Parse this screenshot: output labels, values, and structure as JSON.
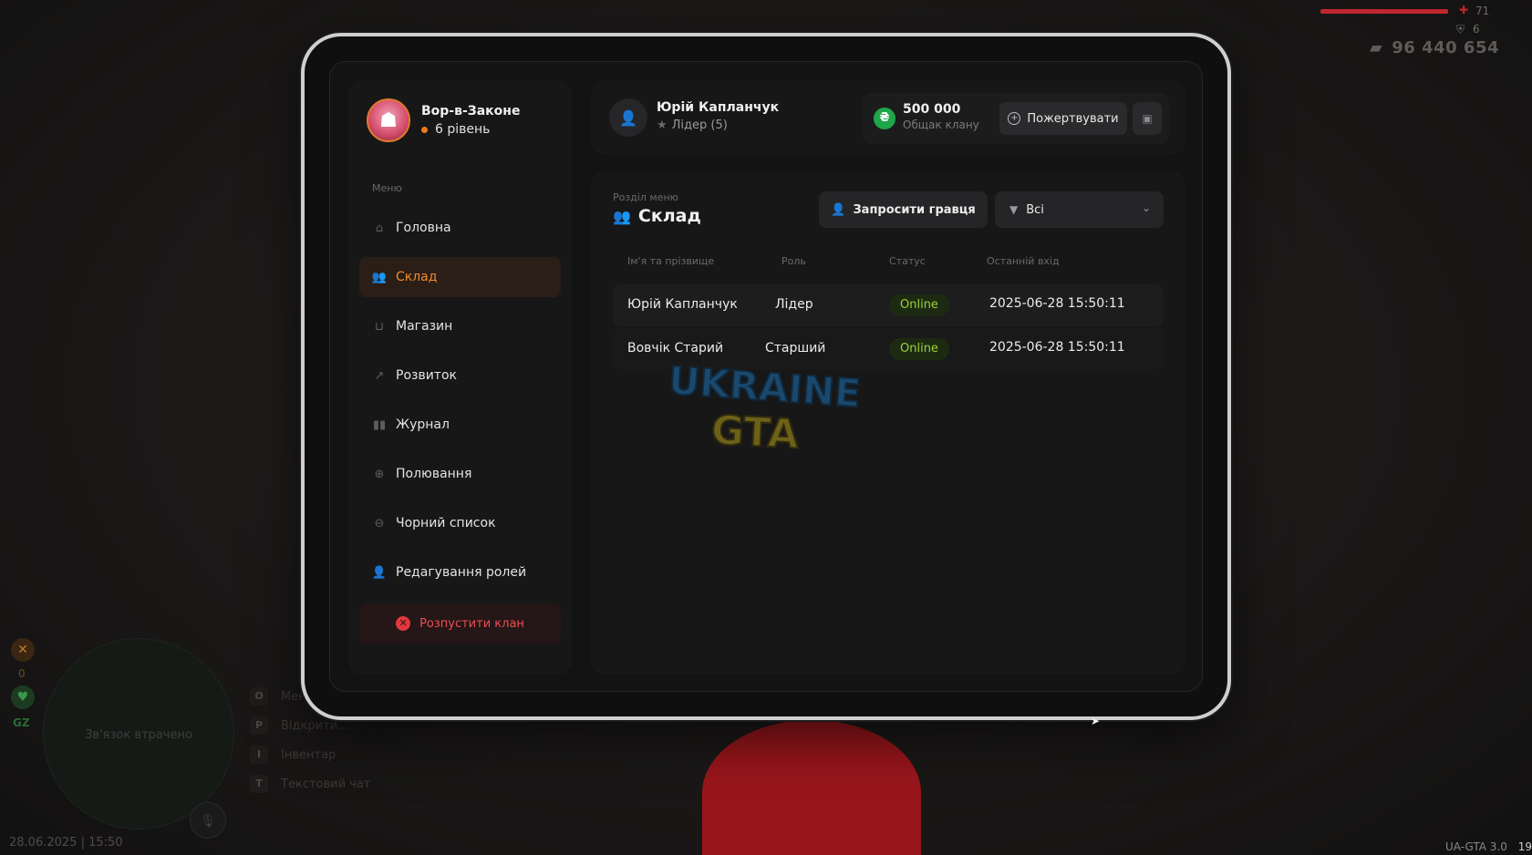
{
  "hud": {
    "health_value": "71",
    "armor_value": "6",
    "money": "96 440 654",
    "minimap_text": "Зв'язок втрачено",
    "minimap_top_value": "0",
    "minimap_label": "GZ",
    "datetime": "28.06.2025 | 15:50",
    "version": "UA-GTA 3.0",
    "version_extra": "19",
    "hints": [
      {
        "key": "O",
        "label": "Меню"
      },
      {
        "key": "P",
        "label": "Відкрити..."
      },
      {
        "key": "I",
        "label": "Інвентар"
      },
      {
        "key": "T",
        "label": "Текстовий чат"
      }
    ]
  },
  "sidebar": {
    "clan_name": "Вор-в-Законе",
    "clan_level": "6 рівень",
    "menu_caption": "Меню",
    "items": [
      {
        "label": "Головна",
        "icon": "home-icon"
      },
      {
        "label": "Склад",
        "icon": "people-icon",
        "active": true
      },
      {
        "label": "Магазин",
        "icon": "basket-icon"
      },
      {
        "label": "Розвиток",
        "icon": "chart-icon"
      },
      {
        "label": "Журнал",
        "icon": "book-icon"
      },
      {
        "label": "Полювання",
        "icon": "crosshair-icon"
      },
      {
        "label": "Чорний список",
        "icon": "block-icon"
      },
      {
        "label": "Редагування ролей",
        "icon": "user-edit-icon"
      }
    ],
    "disband_label": "Розпустити клан"
  },
  "header": {
    "user_name": "Юрій Капланчук",
    "user_role": "Лідер (5)",
    "bank_amount": "500 000",
    "bank_label": "Общак клану",
    "coin_symbol": "₴",
    "donate_label": "Пожертвувати"
  },
  "panel": {
    "section_caption": "Розділ меню",
    "section_title": "Склад",
    "invite_label": "Запросити гравця",
    "filter_value": "Всі",
    "columns": [
      "Ім'я та прізвище",
      "Роль",
      "Статус",
      "Останній вхід"
    ],
    "rows": [
      {
        "name": "Юрій Капланчук",
        "role": "Лідер",
        "status": "Online",
        "last_login": "2025-06-28 15:50:11"
      },
      {
        "name": "Вовчік Старий",
        "role": "Старший",
        "status": "Online",
        "last_login": "2025-06-28 15:50:11"
      }
    ],
    "watermark_line1": "UKRAINE",
    "watermark_line2": "GTA"
  },
  "colors": {
    "accent": "#f08a2a",
    "danger": "#e0393d",
    "online": "#9bd23a",
    "coin": "#1fa64a"
  }
}
